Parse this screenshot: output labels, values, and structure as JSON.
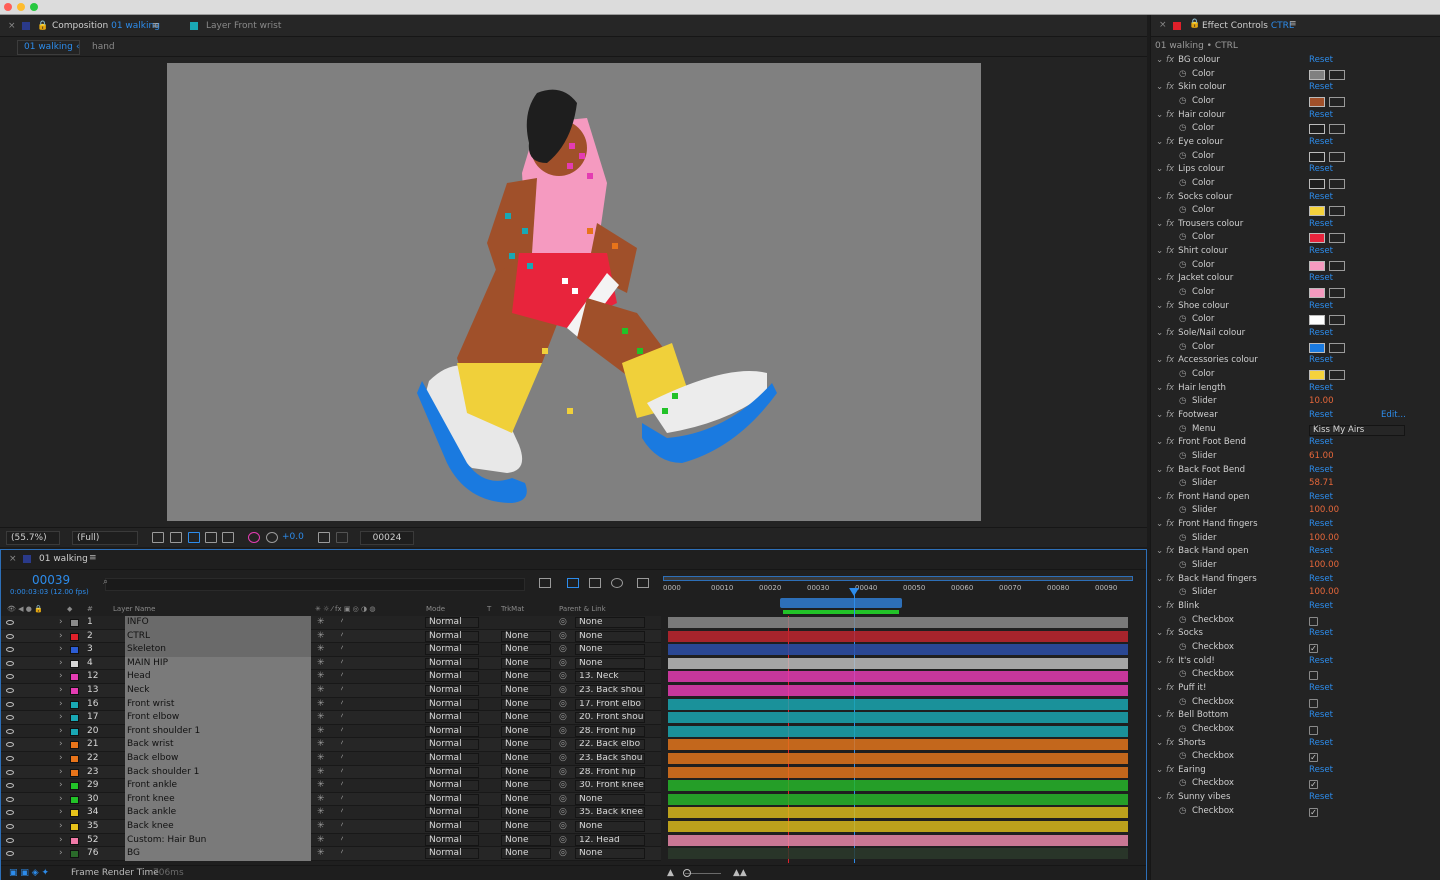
{
  "composition_panel": {
    "tab_title": "Composition",
    "comp_name": "01 walking",
    "layer_tab": "Layer Front wrist",
    "breadcrumbs": [
      "01 walking",
      "hand"
    ],
    "zoom": "(55.7%)",
    "resolution": "(Full)",
    "exposure": "+0.0",
    "frame": "00024"
  },
  "timeline": {
    "comp_name": "01 walking",
    "current_frame": "00039",
    "timecode": "0:00:03:03 (12.00 fps)",
    "col_headers": {
      "layer_name": "Layer Name",
      "mode": "Mode",
      "t": "T",
      "trkmat": "TrkMat",
      "parent": "Parent & Link"
    },
    "ruler": [
      "0000",
      "00010",
      "00020",
      "00030",
      "00040",
      "00050",
      "00060",
      "00070",
      "00080",
      "00090"
    ],
    "footer": "Frame Render Time",
    "render_time": "706ms",
    "layers": [
      {
        "num": "1",
        "name": "INFO",
        "color": "#8a8a8a",
        "mode": "Normal",
        "trkmat": "",
        "parent": "None",
        "bar": "#8a8a8a"
      },
      {
        "num": "2",
        "name": "CTRL",
        "color": "#e0202a",
        "mode": "Normal",
        "trkmat": "None",
        "parent": "None",
        "bar": "#c0262f"
      },
      {
        "num": "3",
        "name": "Skeleton",
        "color": "#2c5cd4",
        "mode": "Normal",
        "trkmat": "None",
        "parent": "None",
        "bar": "#2d4fa8"
      },
      {
        "num": "4",
        "name": "MAIN HIP",
        "color": "#d4d4d4",
        "mode": "Normal",
        "trkmat": "None",
        "parent": "None",
        "bar": "#bdbdbd"
      },
      {
        "num": "12",
        "name": "Head",
        "color": "#e43cb2",
        "mode": "Normal",
        "trkmat": "None",
        "parent": "13. Neck",
        "bar": "#e43cb2"
      },
      {
        "num": "13",
        "name": "Neck",
        "color": "#e43cb2",
        "mode": "Normal",
        "trkmat": "None",
        "parent": "23. Back shou",
        "bar": "#e43cb2"
      },
      {
        "num": "16",
        "name": "Front wrist",
        "color": "#19a8b4",
        "mode": "Normal",
        "trkmat": "None",
        "parent": "17. Front elbo",
        "bar": "#1aa6b0"
      },
      {
        "num": "17",
        "name": "Front elbow",
        "color": "#19a8b4",
        "mode": "Normal",
        "trkmat": "None",
        "parent": "20. Front shou",
        "bar": "#1aa6b0"
      },
      {
        "num": "20",
        "name": "Front shoulder 1",
        "color": "#19a8b4",
        "mode": "Normal",
        "trkmat": "None",
        "parent": "28. Front hip",
        "bar": "#1aa6b0"
      },
      {
        "num": "21",
        "name": "Back wrist",
        "color": "#e8741a",
        "mode": "Normal",
        "trkmat": "None",
        "parent": "22. Back elbo",
        "bar": "#e0741c"
      },
      {
        "num": "22",
        "name": "Back elbow",
        "color": "#e8741a",
        "mode": "Normal",
        "trkmat": "None",
        "parent": "23. Back shou",
        "bar": "#e0741c"
      },
      {
        "num": "23",
        "name": "Back shoulder 1",
        "color": "#e8741a",
        "mode": "Normal",
        "trkmat": "None",
        "parent": "28. Front hip",
        "bar": "#e0741c"
      },
      {
        "num": "29",
        "name": "Front ankle",
        "color": "#22c228",
        "mode": "Normal",
        "trkmat": "None",
        "parent": "30. Front knee",
        "bar": "#27b52a"
      },
      {
        "num": "30",
        "name": "Front knee",
        "color": "#22c228",
        "mode": "Normal",
        "trkmat": "None",
        "parent": "None",
        "bar": "#27b52a"
      },
      {
        "num": "34",
        "name": "Back ankle",
        "color": "#e6c21a",
        "mode": "Normal",
        "trkmat": "None",
        "parent": "35. Back knee",
        "bar": "#d8b81c"
      },
      {
        "num": "35",
        "name": "Back knee",
        "color": "#e6c21a",
        "mode": "Normal",
        "trkmat": "None",
        "parent": "None",
        "bar": "#d8b81c"
      },
      {
        "num": "52",
        "name": "Custom: Hair Bun",
        "color": "#f07aa8",
        "mode": "Normal",
        "trkmat": "None",
        "parent": "12. Head",
        "bar": "#e887a9"
      },
      {
        "num": "76",
        "name": "BG",
        "color": "#2a6a2a",
        "mode": "Normal",
        "trkmat": "None",
        "parent": "None",
        "bar": "#2b3a2b"
      }
    ]
  },
  "effect_controls": {
    "title": "Effect Controls",
    "layer": "CTRL",
    "subtitle": "01 walking • CTRL",
    "reset_label": "Reset",
    "edit_label": "Edit...",
    "effects": [
      {
        "name": "BG colour",
        "prop": "Color",
        "type": "color",
        "value": "#808080"
      },
      {
        "name": "Skin colour",
        "prop": "Color",
        "type": "color",
        "value": "#a0502a"
      },
      {
        "name": "Hair colour",
        "prop": "Color",
        "type": "color",
        "value": "#1e1e1e"
      },
      {
        "name": "Eye colour",
        "prop": "Color",
        "type": "color",
        "value": "#1e1e1e"
      },
      {
        "name": "Lips colour",
        "prop": "Color",
        "type": "color",
        "value": "#1e1e1e"
      },
      {
        "name": "Socks colour",
        "prop": "Color",
        "type": "color",
        "value": "#f5d23c"
      },
      {
        "name": "Trousers colour",
        "prop": "Color",
        "type": "color",
        "value": "#e8243c"
      },
      {
        "name": "Shirt colour",
        "prop": "Color",
        "type": "color",
        "value": "#f59ac0"
      },
      {
        "name": "Jacket colour",
        "prop": "Color",
        "type": "color",
        "value": "#f59ac0"
      },
      {
        "name": "Shoe colour",
        "prop": "Color",
        "type": "color",
        "value": "#ffffff"
      },
      {
        "name": "Sole/Nail colour",
        "prop": "Color",
        "type": "color",
        "value": "#1a7ae0"
      },
      {
        "name": "Accessories colour",
        "prop": "Color",
        "type": "color",
        "value": "#f5d23c"
      },
      {
        "name": "Hair length",
        "prop": "Slider",
        "type": "slider",
        "value": "10.00"
      },
      {
        "name": "Footwear",
        "prop": "Menu",
        "type": "menu",
        "value": "Kiss My Airs"
      },
      {
        "name": "Front Foot Bend",
        "prop": "Slider",
        "type": "slider",
        "value": "61.00"
      },
      {
        "name": "Back Foot Bend",
        "prop": "Slider",
        "type": "slider",
        "value": "58.71"
      },
      {
        "name": "Front Hand open",
        "prop": "Slider",
        "type": "slider",
        "value": "100.00"
      },
      {
        "name": "Front Hand fingers",
        "prop": "Slider",
        "type": "slider",
        "value": "100.00"
      },
      {
        "name": "Back Hand open",
        "prop": "Slider",
        "type": "slider",
        "value": "100.00"
      },
      {
        "name": "Back Hand fingers",
        "prop": "Slider",
        "type": "slider",
        "value": "100.00"
      },
      {
        "name": "Blink",
        "prop": "Checkbox",
        "type": "checkbox",
        "value": false
      },
      {
        "name": "Socks",
        "prop": "Checkbox",
        "type": "checkbox",
        "value": true
      },
      {
        "name": "It's cold!",
        "prop": "Checkbox",
        "type": "checkbox",
        "value": false
      },
      {
        "name": "Puff it!",
        "prop": "Checkbox",
        "type": "checkbox",
        "value": false
      },
      {
        "name": "Bell Bottom",
        "prop": "Checkbox",
        "type": "checkbox",
        "value": false
      },
      {
        "name": "Shorts",
        "prop": "Checkbox",
        "type": "checkbox",
        "value": true
      },
      {
        "name": "Earing",
        "prop": "Checkbox",
        "type": "checkbox",
        "value": true
      },
      {
        "name": "Sunny vibes",
        "prop": "Checkbox",
        "type": "checkbox",
        "value": true
      }
    ]
  }
}
